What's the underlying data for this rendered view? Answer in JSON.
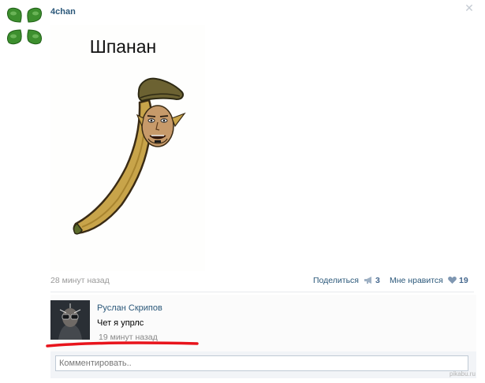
{
  "post": {
    "author": "4chan",
    "image_caption": "Шпанан",
    "time": "28 минут назад",
    "share_label": "Поделиться",
    "share_count": "3",
    "like_label": "Мне нравится",
    "like_count": "19"
  },
  "comment": {
    "author": "Руслан Скрипов",
    "text": "Чет я упрлс",
    "time": "19 минут назад"
  },
  "reply": {
    "placeholder": "Комментировать.."
  },
  "watermark": "pikabu.ru",
  "colors": {
    "link": "#2b587a",
    "counter": "#45688e",
    "clover": "#3d8f2e",
    "underline": "#e8141c"
  },
  "icons": [
    "four-leaf-clover-icon",
    "close-icon",
    "megaphone-icon",
    "heart-icon"
  ]
}
